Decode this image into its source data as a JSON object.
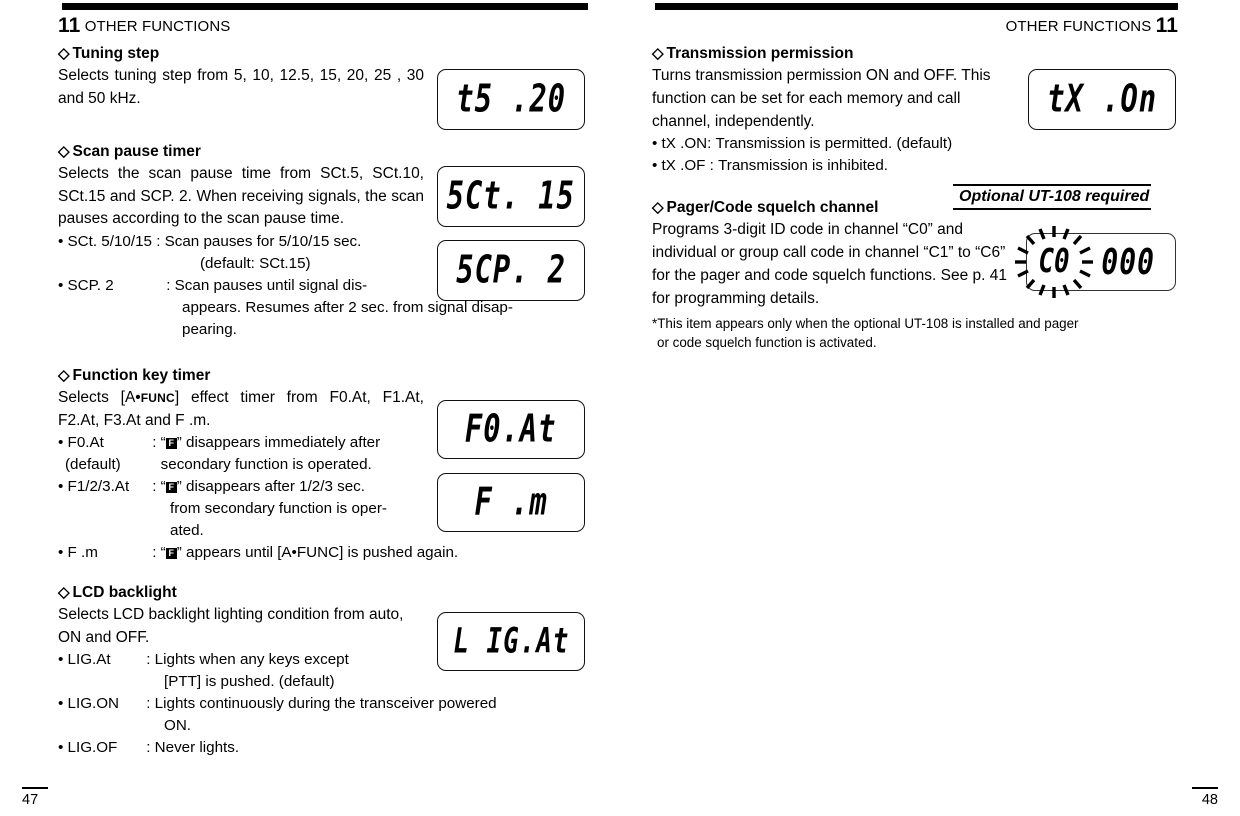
{
  "left_page": {
    "topbar": true,
    "running_head": {
      "chapter": "11",
      "title": "OTHER FUNCTIONS"
    },
    "page_number": "47",
    "sections": [
      {
        "id": "tuning-step",
        "diamond": "◇",
        "heading": "Tuning step",
        "body": "Selects tuning step from 5, 10, 12.5, 15, 20, 25 , 30 and 50 kHz.",
        "lcd": [
          {
            "text": "t5 .20"
          }
        ]
      },
      {
        "id": "scan-pause-timer",
        "diamond": "◇",
        "heading": "Scan pause timer",
        "body": "Selects the scan pause time from SCt.5, SCt.10, SCt.15 and SCP. 2. When receiving signals, the scan pauses according to the scan pause time.",
        "bullets": [
          {
            "label": "• SCt. 5/10/15",
            "sep": " : ",
            "lines": [
              "Scan pauses for 5/10/15 sec.",
              "(default: SCt.15)"
            ]
          },
          {
            "label": "• SCP. 2",
            "sep": " : ",
            "lines": [
              "Scan pauses until signal dis-",
              "appears. Resumes after 2 sec. from signal disap-",
              "pearing."
            ]
          }
        ],
        "lcd": [
          {
            "text": "5Ct. 15"
          },
          {
            "text": "5CP. 2"
          }
        ]
      },
      {
        "id": "function-key-timer",
        "diamond": "◇",
        "heading": "Function key timer",
        "body_pre": "Selects [A•",
        "body_key": "FUNC",
        "body_post": "] effect timer from F0.At, F1.At, F2.At, F3.At and F .m.",
        "bullets": [
          {
            "label": "• F0.At",
            "sublabel": "(default)",
            "sep": " : ",
            "icon": "F",
            "lines": [
              "” disappears immediately after",
              "secondary function is operated."
            ]
          },
          {
            "label": "• F1/2/3.At",
            "sep": " : ",
            "icon": "F",
            "lines": [
              "” disappears after 1/2/3 sec.",
              "from secondary function is oper-",
              "ated."
            ]
          },
          {
            "label": "• F .m",
            "sep": " : ",
            "icon": "F",
            "lines": [
              "” appears until [A•FUNC] is pushed again."
            ]
          }
        ],
        "lcd": [
          {
            "text": "F0.At"
          },
          {
            "text": "F .m"
          }
        ]
      },
      {
        "id": "lcd-backlight",
        "diamond": "◇",
        "heading": "LCD backlight",
        "body": "Selects LCD backlight lighting condition from auto, ON and OFF.",
        "bullets": [
          {
            "label": "• LIG.At",
            "sep": " : ",
            "lines": [
              "Lights when any keys except",
              "[PTT] is pushed. (default)"
            ]
          },
          {
            "label": "• LIG.ON",
            "sep": " : ",
            "lines": [
              "Lights continuously during the transceiver powered",
              "ON."
            ]
          },
          {
            "label": "• LIG.OF",
            "sep": " : ",
            "lines": [
              "Never lights."
            ]
          }
        ],
        "lcd": [
          {
            "text": "L IG.At"
          }
        ]
      }
    ]
  },
  "right_page": {
    "topbar": true,
    "running_head": {
      "chapter": "11",
      "title": "OTHER FUNCTIONS"
    },
    "page_number": "48",
    "sections": [
      {
        "id": "transmission-permission",
        "diamond": "◇",
        "heading": "Transmission permission",
        "body": "Turns transmission permission ON and OFF. This function can be set for each memory and call channel, independently.",
        "bullets": [
          {
            "label": "• tX .ON: ",
            "lines": [
              "Transmission is permitted. (default)"
            ]
          },
          {
            "label": "• tX .OF : ",
            "lines": [
              "Transmission is inhibited."
            ]
          }
        ],
        "lcd": [
          {
            "text": "tX .On"
          }
        ]
      },
      {
        "id": "pager-code-squelch-channel",
        "diamond": "◇",
        "heading": "Pager/Code squelch channel",
        "banner": "Optional UT-108 required",
        "body": "Programs 3-digit ID code in channel “C0” and individual or group call code in channel “C1” to “C6” for the pager and code squelch functions. See p. 41 for programming details.",
        "footnote": {
          "line1": "*This item appears only when the optional UT-108 is installed and pager",
          "line2": "or code squelch function is activated."
        },
        "lcd_blink": {
          "channel": "C0",
          "value": "000",
          "blinking": true
        }
      }
    ]
  }
}
